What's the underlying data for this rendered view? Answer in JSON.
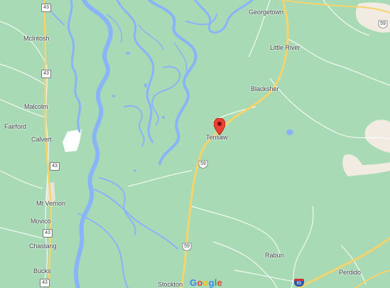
{
  "map": {
    "provider_logo": {
      "letters": [
        {
          "ch": "G",
          "color": "#4285f4"
        },
        {
          "ch": "o",
          "color": "#ea4335"
        },
        {
          "ch": "o",
          "color": "#fbbc05"
        },
        {
          "ch": "g",
          "color": "#4285f4"
        },
        {
          "ch": "l",
          "color": "#34a853"
        },
        {
          "ch": "e",
          "color": "#ea4335"
        }
      ]
    },
    "colors": {
      "land": "#a8dab5",
      "water": "#8ab4f8",
      "highway": "#f6d36b",
      "pin": "#ea4335",
      "urban": "#f1ebe1"
    },
    "places": {
      "georgetown": "Georgetown",
      "mcintosh": "McIntosh",
      "little_river": "Little River",
      "blacksher": "Blacksher",
      "malcolm": "Malcolm",
      "fairford": "Fairford",
      "calvert": "Calvert",
      "tensaw": "Tensaw",
      "mt_vernon": "Mt Vernon",
      "movico": "Movico",
      "chastang": "Chastang",
      "rabun": "Rabun",
      "bucks": "Bucks",
      "stockton": "Stockton",
      "perdido": "Perdido"
    },
    "shields": {
      "al43_a": "43",
      "al43_b": "43",
      "al43_c": "43",
      "al43_d": "43",
      "al43_e": "43",
      "us59_a": "59",
      "us59_b": "59",
      "us59_c": "59",
      "i65": "65"
    },
    "marker": {
      "name": "location-pin",
      "place": "Tensaw"
    }
  }
}
